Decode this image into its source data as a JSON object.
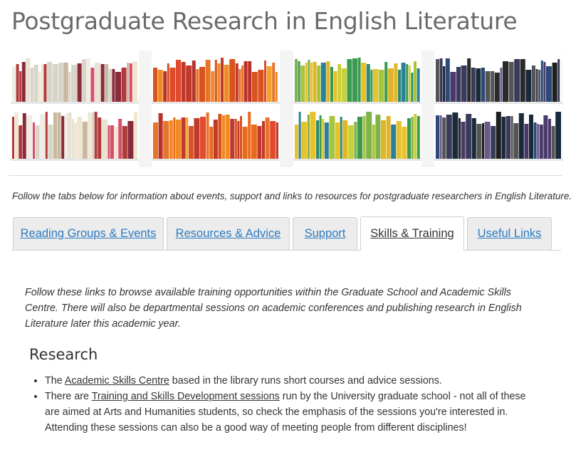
{
  "page": {
    "title": "Postgraduate Research in English Literature",
    "intro": "Follow the tabs below for information about events, support and links to resources for postgraduate researchers in English Literature."
  },
  "banner": {
    "image": "bookshelves-by-colour",
    "colors": [
      "#e8e6df",
      "#c8372d",
      "#e8b92a",
      "#3c8f52",
      "#2a4f8a",
      "#2a2a2a"
    ]
  },
  "tabs": [
    {
      "label": "Reading Groups & Events",
      "active": false
    },
    {
      "label": "Resources & Advice",
      "active": false
    },
    {
      "label": "Support",
      "active": false
    },
    {
      "label": "Skills & Training",
      "active": true
    },
    {
      "label": "Useful Links",
      "active": false
    }
  ],
  "content": {
    "intro": "Follow these links to browse available training opportunities within the Graduate School and Academic Skills Centre. There will also be departmental sessions on academic conferences and publishing research in English Literature later this academic year.",
    "section_heading": "Research",
    "items": [
      {
        "before": "The ",
        "link": "Academic Skills Centre",
        "after": " based in the library runs short courses and advice sessions."
      },
      {
        "before": "There are ",
        "link": "Training and Skills Development sessions",
        "after": " run by the University graduate school - not all of these are aimed at Arts and Humanities students, so check the emphasis of the sessions you're interested in. Attending these sessions can also be a good way of meeting people from different disciplines!"
      }
    ]
  },
  "colors": {
    "link": "#2e7bbf",
    "title": "#6a6a6a",
    "tab_bg": "#ececec"
  }
}
